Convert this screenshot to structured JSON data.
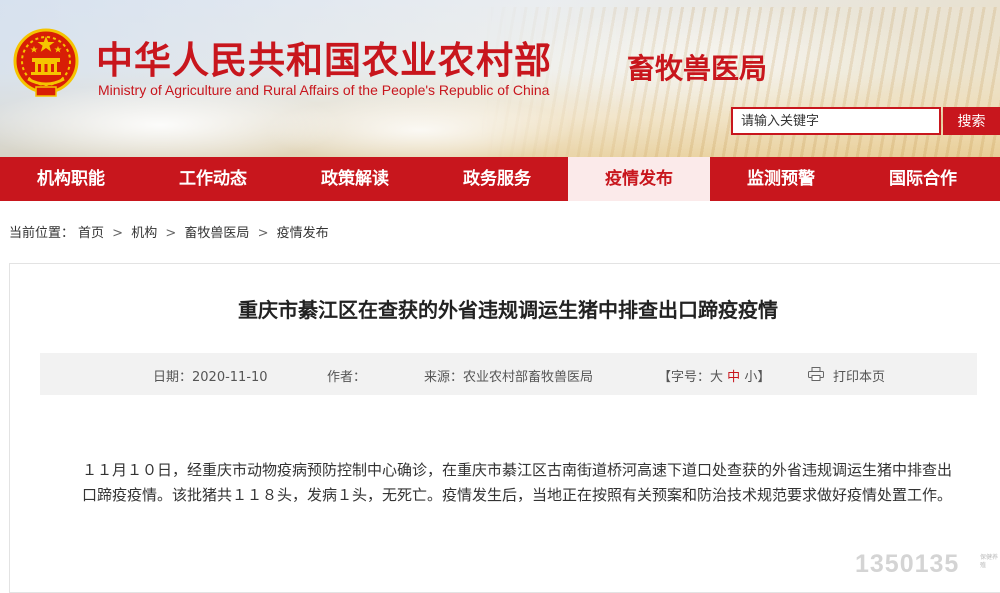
{
  "header": {
    "site_title": "中华人民共和国农业农村部",
    "site_subtitle": "Ministry of Agriculture  and  Rural  Affairs  of the People's Republic of China",
    "bureau_name": "畜牧兽医局",
    "search_placeholder": "请输入关键字",
    "search_button": "搜索",
    "colors": {
      "brand_red": "#c8161d",
      "emblem_gold": "#f5c400"
    }
  },
  "nav": {
    "items": [
      {
        "label": "机构职能"
      },
      {
        "label": "工作动态"
      },
      {
        "label": "政策解读"
      },
      {
        "label": "政务服务"
      },
      {
        "label": "疫情发布",
        "active": true
      },
      {
        "label": "监测预警"
      },
      {
        "label": "国际合作"
      }
    ]
  },
  "breadcrumb": {
    "prefix": "当前位置：",
    "items": [
      "首页",
      "机构",
      "畜牧兽医局",
      "疫情发布"
    ],
    "separator": ">"
  },
  "article": {
    "title": "重庆市綦江区在查获的外省违规调运生猪中排查出口蹄疫疫情",
    "date": "日期：2020-11-10",
    "author": "作者：",
    "source": "来源：农业农村部畜牧兽医局",
    "font_size_prefix": "【字号：",
    "font_size_large": "大",
    "font_size_medium": "中",
    "font_size_small": "小",
    "font_size_suffix": "】",
    "print": "打印本页",
    "body": "１１月１０日，经重庆市动物疫病预防控制中心确诊，在重庆市綦江区古南街道桥河高速下道口处查获的外省违规调运生猪中排查出口蹄疫疫情。该批猪共１１８头，发病１头，无死亡。疫情发生后，当地正在按照有关预案和防治技术规范要求做好疫情处置工作。"
  },
  "watermark": {
    "number": "1350135",
    "caption": "保健养殖"
  }
}
